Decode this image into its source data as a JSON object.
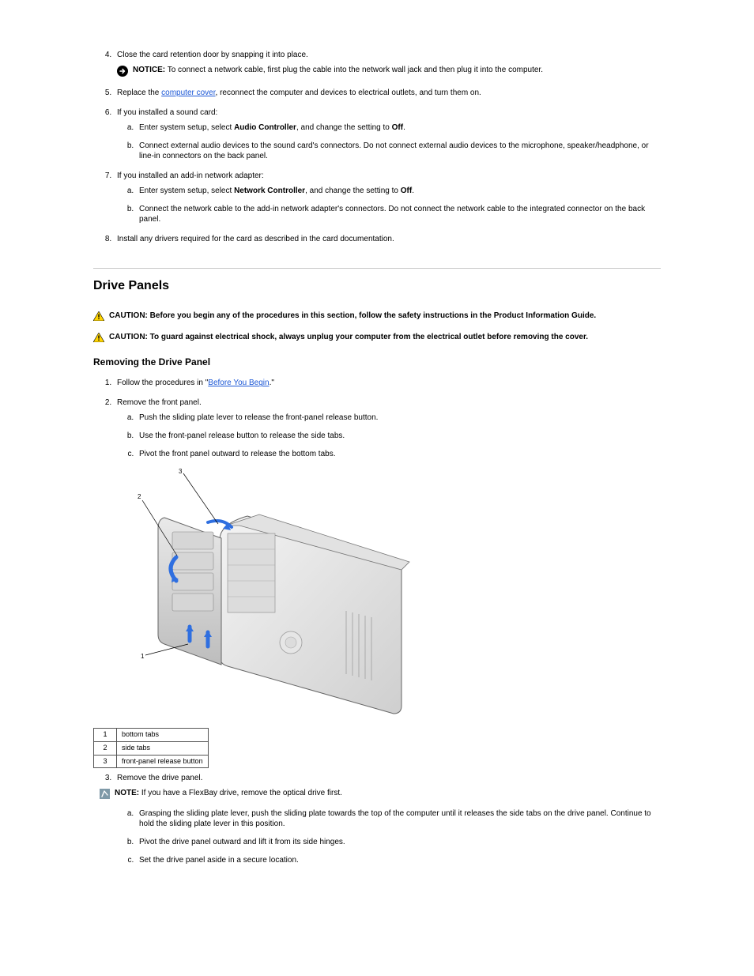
{
  "step4": {
    "text": "Close the card retention door by snapping it into place."
  },
  "notice1": {
    "label": "NOTICE:",
    "text_a": "To connect a network cable, first plug the cable into the network wall jack and then plug it into the computer."
  },
  "step5": {
    "lead": "Replace the ",
    "link": "computer cover",
    "tail": ", reconnect the computer and devices to electrical outlets, and turn them on."
  },
  "step6": {
    "text": "If you installed a sound card:"
  },
  "step6a": {
    "text_a": "Enter system setup, select ",
    "bold_a": "Audio Controller",
    "text_b": ", and change the setting to ",
    "bold_b": "Off",
    "tail": "."
  },
  "step6b": {
    "text": "Connect external audio devices to the sound card's connectors. Do not connect external audio devices to the microphone, speaker/headphone, or line-in connectors on the back panel."
  },
  "step7": {
    "text": "If you installed an add-in network adapter:"
  },
  "step7a": {
    "text_a": "Enter system setup, select ",
    "bold_a": "Network Controller",
    "text_b": ", and change the setting to ",
    "bold_b": "Off",
    "tail": "."
  },
  "step7b": {
    "text": "Connect the network cable to the add-in network adapter's connectors. Do not connect the network cable to the integrated connector on the back panel."
  },
  "step8": {
    "text": "Install any drivers required for the card as described in the card documentation."
  },
  "section_title": "Drive Panels",
  "caution1": {
    "label": "CAUTION:",
    "text": "Before you begin any of the procedures in this section, follow the safety instructions in the Product Information Guide."
  },
  "caution2": {
    "label": "CAUTION:",
    "text": "To guard against electrical shock, always unplug your computer from the electrical outlet before removing the cover."
  },
  "subsection_title": "Removing the Drive Panel",
  "rstep1": {
    "lead": "Follow the procedures in \"",
    "link": "Before You Begin",
    "tail": ".\""
  },
  "rstep2": {
    "text": "Remove the front panel."
  },
  "rstep2a": {
    "text": "Push the sliding plate lever to release the front-panel release button."
  },
  "rstep2b": {
    "text": "Use the front-panel release button to release the side tabs."
  },
  "rstep2c": {
    "text": "Pivot the front panel outward to release the bottom tabs."
  },
  "legend": {
    "rows": [
      {
        "n": "1",
        "label": "bottom tabs"
      },
      {
        "n": "2",
        "label": "side tabs"
      },
      {
        "n": "3",
        "label": "front-panel release button"
      }
    ]
  },
  "rstep3": {
    "text": "Remove the drive panel."
  },
  "note1": {
    "label": "NOTE:",
    "text": "If you have a FlexBay drive, remove the optical drive first."
  },
  "rstep3a": {
    "text": "Grasping the sliding plate lever, push the sliding plate towards the top of the computer until it releases the side tabs on the drive panel. Continue to hold the sliding plate lever in this position."
  },
  "rstep3b": {
    "text": "Pivot the drive panel outward and lift it from its side hinges."
  },
  "rstep3c": {
    "text": "Set the drive panel aside in a secure location."
  }
}
